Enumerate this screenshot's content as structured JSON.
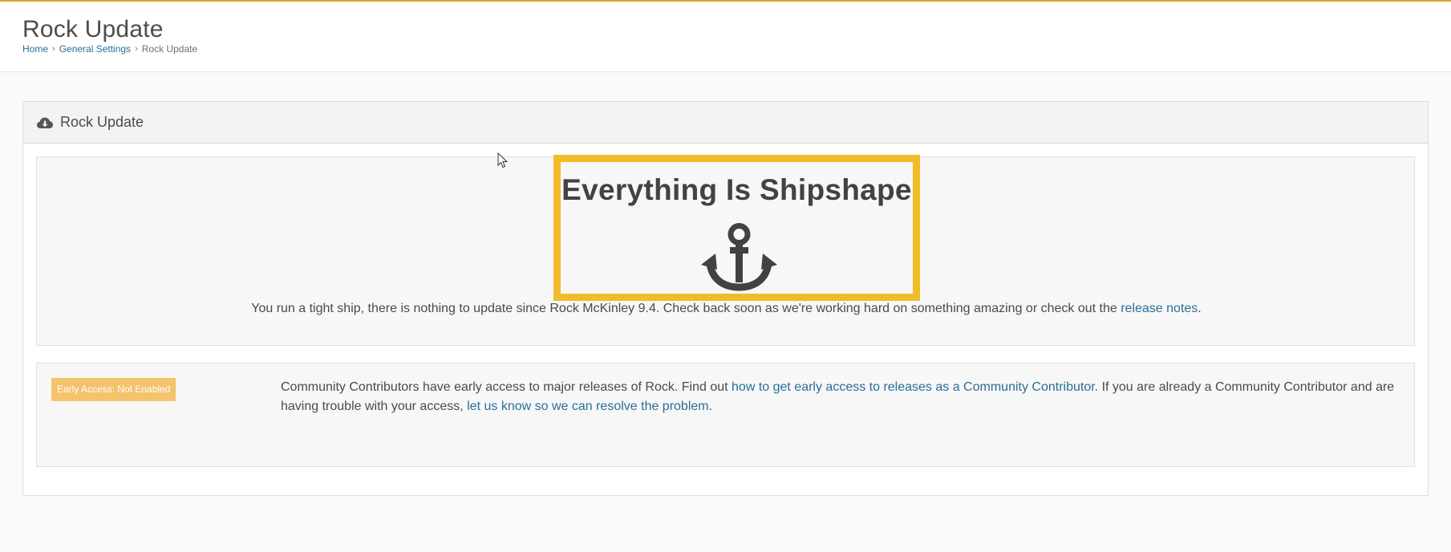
{
  "header": {
    "title": "Rock Update",
    "breadcrumb": {
      "home": "Home",
      "sep": "›",
      "settings": "General Settings",
      "current": "Rock Update"
    }
  },
  "panel": {
    "icon": "cloud-download-icon",
    "title": "Rock Update"
  },
  "status": {
    "headline": "Everything Is Shipshape",
    "icon": "anchor-icon",
    "message_before": "You run a tight ship, there is nothing to update since Rock McKinley 9.4. Check back soon as we're working hard on something amazing or check out the ",
    "release_notes_link": "release notes",
    "message_after": "."
  },
  "early_access": {
    "badge": "Early Access: Not Enabled",
    "text_1": "Community Contributors have early access to major releases of Rock. Find out ",
    "link_1": "how to get early access to releases as a Community Contributor",
    "text_2": ". If you are already a Community Contributor and are having trouble with your access, ",
    "link_2": "let us know so we can resolve the problem",
    "text_3": "."
  },
  "colors": {
    "accent_border": "#f1bb2a",
    "link": "#2a6f96",
    "badge_bg": "#f4c36c",
    "top_line": "#d8a531"
  }
}
